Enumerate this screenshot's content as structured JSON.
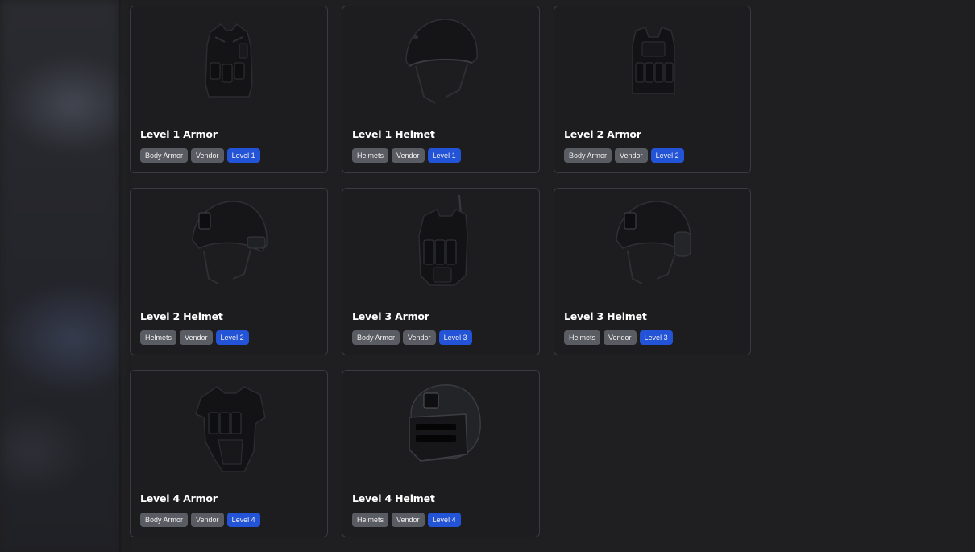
{
  "items": [
    {
      "title": "Level 1 Armor",
      "category": "Body Armor",
      "source": "Vendor",
      "level": "Level 1",
      "kind": "vest-light"
    },
    {
      "title": "Level 1 Helmet",
      "category": "Helmets",
      "source": "Vendor",
      "level": "Level 1",
      "kind": "helmet-basic"
    },
    {
      "title": "Level 2 Armor",
      "category": "Body Armor",
      "source": "Vendor",
      "level": "Level 2",
      "kind": "vest-carrier"
    },
    {
      "title": "Level 2 Helmet",
      "category": "Helmets",
      "source": "Vendor",
      "level": "Level 2",
      "kind": "helmet-tactical"
    },
    {
      "title": "Level 3 Armor",
      "category": "Body Armor",
      "source": "Vendor",
      "level": "Level 3",
      "kind": "vest-heavy"
    },
    {
      "title": "Level 3 Helmet",
      "category": "Helmets",
      "source": "Vendor",
      "level": "Level 3",
      "kind": "helmet-tactical-ears"
    },
    {
      "title": "Level 4 Armor",
      "category": "Body Armor",
      "source": "Vendor",
      "level": "Level 4",
      "kind": "vest-full"
    },
    {
      "title": "Level 4 Helmet",
      "category": "Helmets",
      "source": "Vendor",
      "level": "Level 4",
      "kind": "helmet-visor"
    }
  ],
  "colors": {
    "level_badge": "#2353d6",
    "tag": "#5a5c63",
    "card_bg": "#1d1d1f",
    "card_border": "#3a3b40"
  }
}
